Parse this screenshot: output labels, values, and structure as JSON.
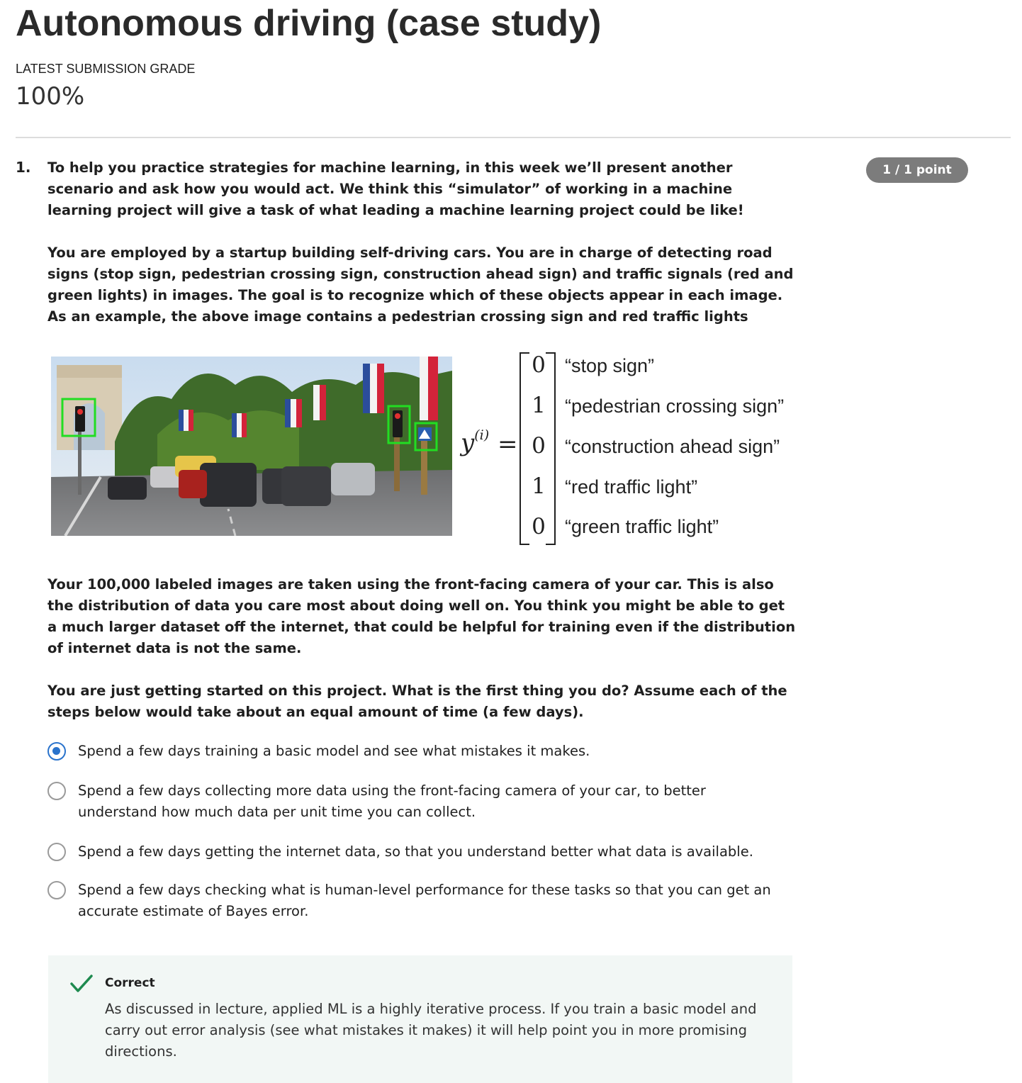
{
  "header": {
    "title": "Autonomous driving (case study)",
    "grade_label": "LATEST SUBMISSION GRADE",
    "grade_value": "100%"
  },
  "question": {
    "number": "1.",
    "points": "1 / 1 point",
    "paragraphs": [
      "To help you practice strategies for machine learning, in this week we’ll present another scenario and ask how you would act. We think this “simulator” of working in a machine learning project will give a task of what leading a machine learning project could be like!",
      "You are employed by a startup building self-driving cars. You are in charge of detecting road signs (stop sign, pedestrian crossing sign, construction ahead sign) and traffic signals (red and green lights) in images. The goal is to recognize which of these objects appear in each image. As an example, the above image contains a pedestrian crossing sign and red traffic lights",
      "Your 100,000 labeled images are taken using the front-facing camera of your car. This is also the distribution of data you care most about doing well on. You think you might be able to get a much larger dataset off the internet, that could be helpful for training even if the distribution of internet data is not the same.",
      "You are just getting started on this project. What is the first thing you do? Assume each of the steps below would take about an equal amount of time (a few days)."
    ],
    "figure": {
      "y_symbol": "y",
      "y_superscript": "(i)",
      "equals": "=",
      "vector": [
        {
          "value": "0",
          "label": "“stop sign”"
        },
        {
          "value": "1",
          "label": "“pedestrian crossing sign”"
        },
        {
          "value": "0",
          "label": "“construction ahead sign”"
        },
        {
          "value": "1",
          "label": "“red traffic light”"
        },
        {
          "value": "0",
          "label": "“green traffic light”"
        }
      ]
    },
    "options": [
      {
        "text": "Spend a few days training a basic model and see what mistakes it makes.",
        "selected": true
      },
      {
        "text": "Spend a few days collecting more data using the front-facing camera of your car, to better understand how much data per unit time you can collect.",
        "selected": false
      },
      {
        "text": "Spend a few days getting the internet data, so that you understand better what data is available.",
        "selected": false
      },
      {
        "text": "Spend a few days checking what is human-level performance for these tasks so that you can get an accurate estimate of Bayes error.",
        "selected": false
      }
    ],
    "feedback": {
      "status": "Correct",
      "text": "As discussed in lecture, applied ML is a highly iterative process. If you train a basic model and carry out error analysis (see what mistakes it makes) it will help point you in more promising directions."
    }
  },
  "colors": {
    "accent_blue": "#2a73cc",
    "correct_green": "#1e8a4f",
    "feedback_bg": "#f2f7f5",
    "points_badge": "#7c7c7c"
  }
}
